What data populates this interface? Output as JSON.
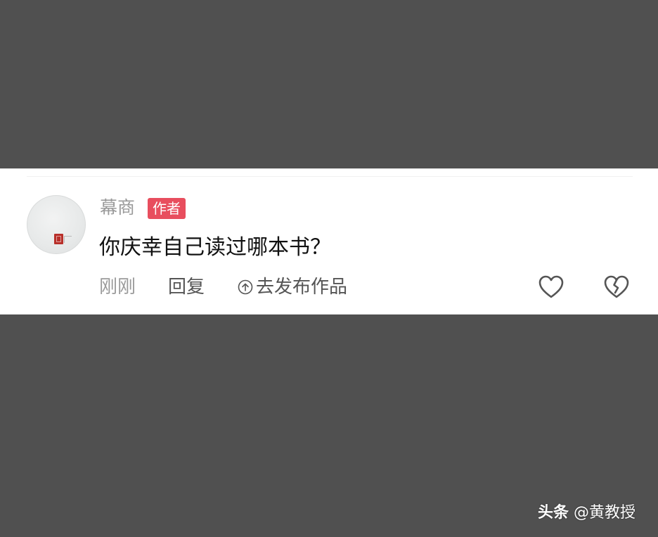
{
  "comment": {
    "username": "幕商",
    "author_badge": "作者",
    "text": "你庆幸自己读过哪本书？",
    "time": "刚刚",
    "reply_label": "回复",
    "publish_label": "去发布作品",
    "like_icon": "heart-icon",
    "dislike_icon": "broken-heart-icon",
    "badge_color": "#e84e5e"
  },
  "watermark": {
    "brand": "头条",
    "handle": "@黄教授"
  }
}
